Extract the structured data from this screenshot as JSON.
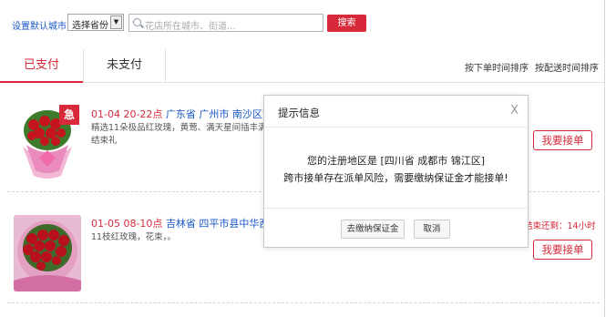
{
  "topbar": {
    "set_city_label": "设置默认城市",
    "province_select_value": "选择省份",
    "search_placeholder": "花店所在城市、街道...",
    "search_button": "搜索"
  },
  "tabs": {
    "paid": "已支付",
    "unpaid": "未支付",
    "sort_by_order_time": "按下单时间排序",
    "sort_by_delivery_time": "按配送时间排序"
  },
  "orders": [
    {
      "urgent_badge": "急",
      "date": "01-04 20-22点",
      "address": "广东省 广州市 南沙区南沙",
      "desc_line1": "精选11朵极品红玫瑰，黄莺、满天星间插丰满,粉色",
      "desc_line2": "结束礼",
      "accept_button": "我要接单"
    },
    {
      "date": "01-05 08-10点",
      "address": "吉林省 四平市县中华西路4",
      "desc_line1": "11枝红玫瑰，花束，。",
      "deadline": "结束还剩：14小时",
      "accept_button": "我要接单"
    }
  ],
  "modal": {
    "title": "提示信息",
    "close": "X",
    "line1": "您的注册地区是 [四川省 成都市 锦江区]",
    "line2": "跨市接单存在派单风险，需要缴纳保证金才能接单!",
    "deposit_button": "去缴纳保证金",
    "cancel_button": "取消"
  },
  "colors": {
    "accent_red": "#d8293a",
    "link_blue": "#1a57c8"
  }
}
